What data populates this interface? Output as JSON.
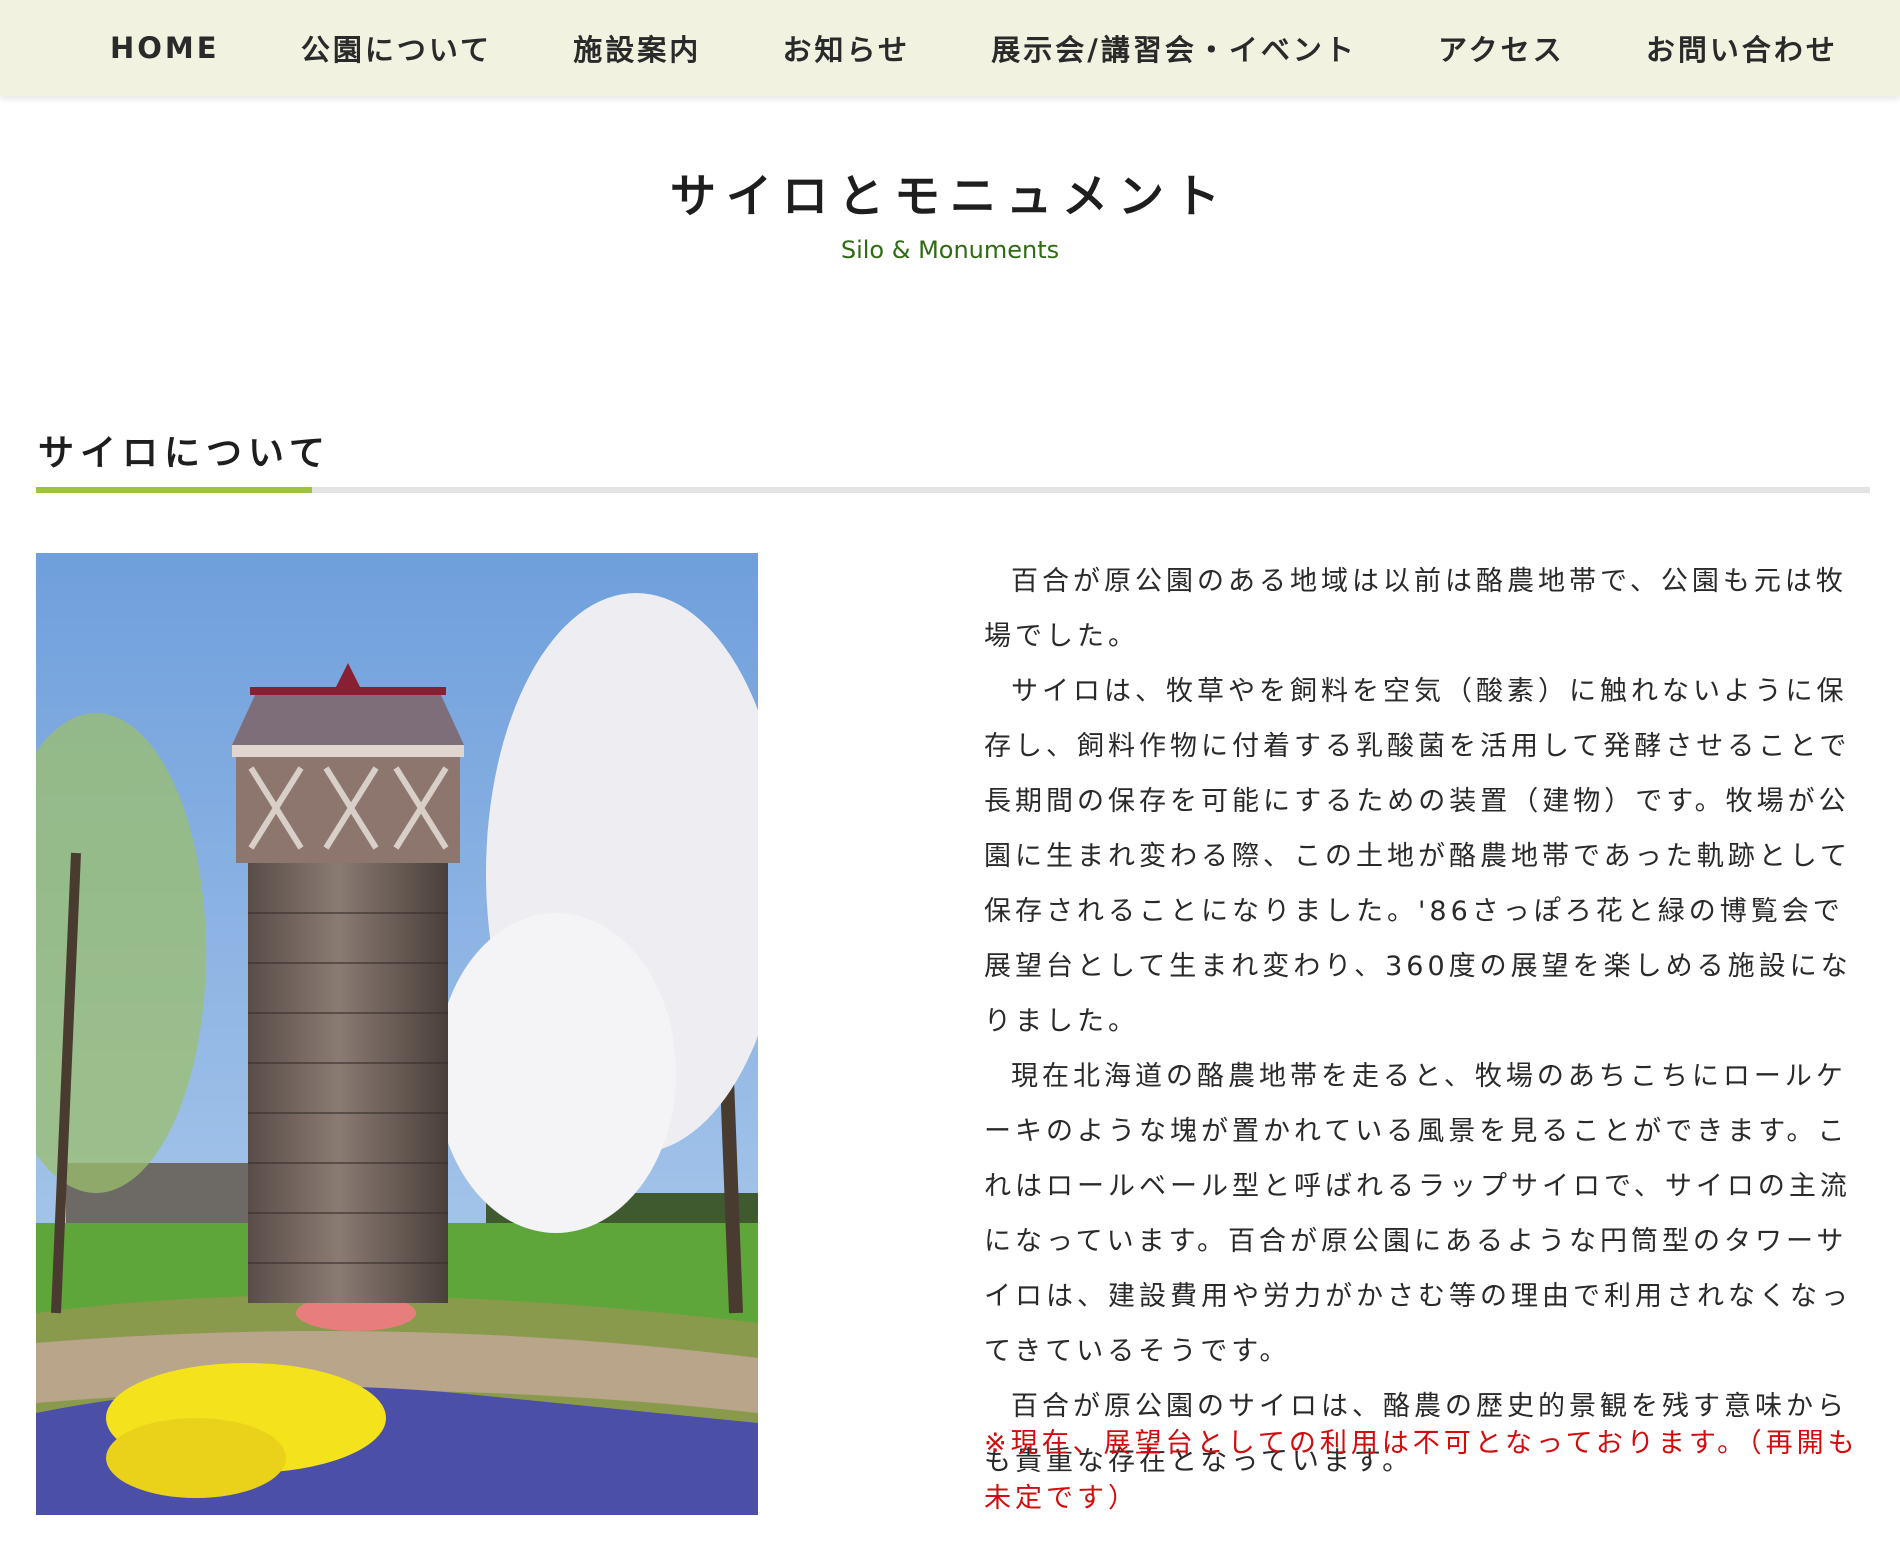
{
  "nav": {
    "items": [
      {
        "label": "HOME"
      },
      {
        "label": "公園について"
      },
      {
        "label": "施設案内"
      },
      {
        "label": "お知らせ"
      },
      {
        "label": "展示会/講習会・イベント"
      },
      {
        "label": "アクセス"
      },
      {
        "label": "お問い合わせ"
      }
    ]
  },
  "page": {
    "title": "サイロとモニュメント",
    "subtitle": "Silo & Monuments"
  },
  "section": {
    "heading": "サイロについて",
    "paragraphs": [
      "百合が原公園のある地域は以前は酪農地帯で、公園も元は牧場でした。",
      "サイロは、牧草やを飼料を空気（酸素）に触れないように保存し、飼料作物に付着する乳酸菌を活用して発酵させることで長期間の保存を可能にするための装置（建物）です。牧場が公園に生まれ変わる際、この土地が酪農地帯であった軌跡として保存されることになりました。'86さっぽろ花と緑の博覧会で展望台として生まれ変わり、360度の展望を楽しめる施設になりました。",
      "現在北海道の酪農地帯を走ると、牧場のあちこちにロールケーキのような塊が置かれている風景を見ることができます。これはロールベール型と呼ばれるラップサイロで、サイロの主流になっています。百合が原公園にあるような円筒型のタワーサイロは、建設費用や労力がかさむ等の理由で利用されなくなってきているそうです。",
      "百合が原公園のサイロは、酪農の歴史的景観を残す意味からも貴重な存在となっています。"
    ],
    "notice": "※現在、展望台としての利用は不可となっております。（再開も未定です）"
  },
  "colors": {
    "nav_background": "#f1f3e0",
    "accent_green": "#9dc43c",
    "subtitle_green": "#2f6b12",
    "notice_red": "#d20c0c"
  }
}
